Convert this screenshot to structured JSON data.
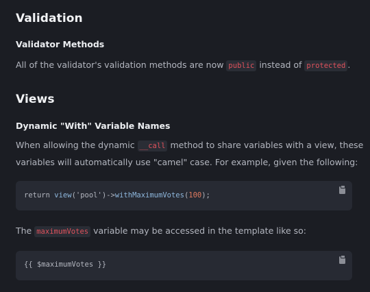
{
  "sections": {
    "validation": {
      "heading": "Validation",
      "subheading": "Validator Methods",
      "text_before": "All of the validator's validation methods are now ",
      "code1": "public",
      "text_middle": " instead of ",
      "code2": "protected",
      "text_after": "."
    },
    "views": {
      "heading": "Views",
      "subheading": "Dynamic \"With\" Variable Names",
      "line1_before": "When allowing the dynamic ",
      "line1_code": "__call",
      "line1_after": " method to share variables with a view, these",
      "line2": "variables will automatically use \"camel\" case. For example, given the following:",
      "code_block1": {
        "kw": "return ",
        "fn1": "view",
        "str": "('pool')->",
        "fn2": "withMaximumVotes",
        "p1": "(",
        "num": "100",
        "p2": ");"
      },
      "para2_before": "The ",
      "para2_code": "maximumVotes",
      "para2_after": " variable may be accessed in the template like so:",
      "code_block2": "{{ $maximumVotes }}"
    }
  },
  "icons": {
    "copy": "clipboard-icon"
  }
}
